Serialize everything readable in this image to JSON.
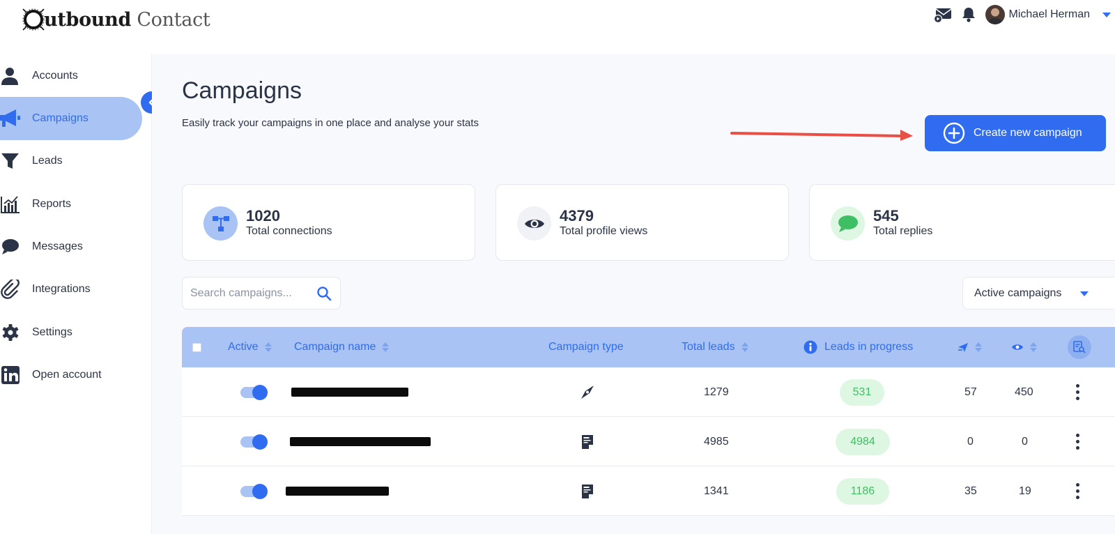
{
  "app": {
    "logo_letter": "O",
    "logo_word1": "utbound",
    "logo_word2": "Contact"
  },
  "header": {
    "user_name": "Michael Herman",
    "icons": [
      "mail-play-icon",
      "bell-icon",
      "avatar",
      "caret-down-icon"
    ]
  },
  "sidebar": {
    "items": [
      {
        "label": "Accounts",
        "icon": "user-icon",
        "active": false
      },
      {
        "label": "Campaigns",
        "icon": "megaphone-icon",
        "active": true
      },
      {
        "label": "Leads",
        "icon": "funnel-icon",
        "active": false
      },
      {
        "label": "Reports",
        "icon": "chart-icon",
        "active": false
      },
      {
        "label": "Messages",
        "icon": "chat-icon",
        "active": false
      },
      {
        "label": "Integrations",
        "icon": "paperclip-icon",
        "active": false
      },
      {
        "label": "Settings",
        "icon": "gear-icon",
        "active": false
      },
      {
        "label": "Open account",
        "icon": "linkedin-icon",
        "active": false
      }
    ]
  },
  "main": {
    "title": "Campaigns",
    "subtitle": "Easily track your campaigns in one place and analyse your stats",
    "create_button": "Create new campaign",
    "stats": [
      {
        "value": "1020",
        "label": "Total connections",
        "icon": "network-icon"
      },
      {
        "value": "4379",
        "label": "Total profile views",
        "icon": "eye-icon"
      },
      {
        "value": "545",
        "label": "Total replies",
        "icon": "chat-bubble-icon"
      }
    ],
    "search": {
      "placeholder": "Search campaigns..."
    },
    "filter": {
      "selected": "Active campaigns"
    },
    "table": {
      "columns": {
        "active": "Active",
        "name": "Campaign name",
        "type": "Campaign type",
        "total_leads": "Total leads",
        "in_progress": "Leads in progress"
      },
      "rows": [
        {
          "active": true,
          "type_icon": "compass-icon",
          "total_leads": "1279",
          "in_progress": "531",
          "sent": "57",
          "views": "450"
        },
        {
          "active": true,
          "type_icon": "csv-file-icon",
          "total_leads": "4985",
          "in_progress": "4984",
          "sent": "0",
          "views": "0"
        },
        {
          "active": true,
          "type_icon": "csv-file-icon",
          "total_leads": "1341",
          "in_progress": "1186",
          "sent": "35",
          "views": "19"
        }
      ]
    }
  },
  "colors": {
    "accent": "#2f6cf0",
    "accent_light": "#a9c3f5",
    "success": "#3fbf63",
    "success_bg": "#def7e2",
    "annotation_arrow": "#ea4f45",
    "text": "#2b3446"
  }
}
